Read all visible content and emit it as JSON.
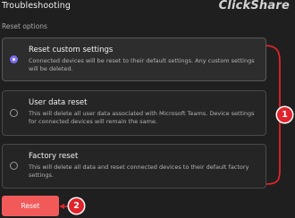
{
  "header": {
    "title": "Troubleshooting",
    "brand": "ClickShare"
  },
  "section_label": "Reset options",
  "options": [
    {
      "title": "Reset custom settings",
      "description": "Connected devices will be reset to their default settings. Any custom settings will be deleted.",
      "selected": true
    },
    {
      "title": "User data reset",
      "description": "This will delete all user data associated with Microsoft Teams. Device settings for connected devices will remain the same.",
      "selected": false
    },
    {
      "title": "Factory reset",
      "description": "This will delete all data and reset connected devices to their default factory settings.",
      "selected": false
    }
  ],
  "reset_button": {
    "label": "Reset"
  },
  "callouts": {
    "options": "1",
    "reset": "2"
  },
  "colors": {
    "accent": "#7c6ff0",
    "reset_button": "#f25a5a",
    "callout": "#e0242b"
  }
}
